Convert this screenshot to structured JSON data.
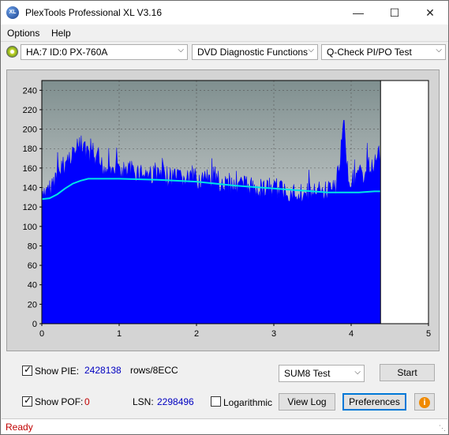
{
  "window": {
    "title": "PlexTools Professional XL V3.16",
    "icon": "XL"
  },
  "menu": {
    "items": [
      "Options",
      "Help"
    ]
  },
  "toolbar": {
    "drive": "HA:7 ID:0  PX-760A",
    "function": "DVD Diagnostic Functions",
    "test": "Q-Check PI/PO Test"
  },
  "chart_data": {
    "type": "area",
    "x_ticks": [
      "0",
      "1",
      "2",
      "3",
      "4",
      "5"
    ],
    "y_ticks": [
      "0",
      "20",
      "40",
      "60",
      "80",
      "100",
      "120",
      "140",
      "160",
      "180",
      "200",
      "220",
      "240"
    ],
    "xlim": [
      0,
      5
    ],
    "ylim": [
      0,
      250
    ],
    "grid": true,
    "end_marker_x": 4.38,
    "series": [
      {
        "color": "#0000ff",
        "x": [
          0,
          0.1,
          0.2,
          0.3,
          0.4,
          0.5,
          0.6,
          0.7,
          0.8,
          0.9,
          1.0,
          1.2,
          1.4,
          1.6,
          1.8,
          2.0,
          2.2,
          2.4,
          2.6,
          2.8,
          3.0,
          3.2,
          3.4,
          3.6,
          3.8,
          3.85,
          3.9,
          3.95,
          4.0,
          4.1,
          4.2,
          4.3,
          4.38
        ],
        "y": [
          138,
          148,
          165,
          175,
          188,
          195,
          183,
          178,
          172,
          170,
          168,
          168,
          165,
          162,
          160,
          160,
          158,
          155,
          154,
          150,
          150,
          147,
          145,
          145,
          152,
          175,
          228,
          168,
          158,
          160,
          167,
          178,
          185
        ]
      },
      {
        "color": "#00e5e5",
        "x": [
          0,
          0.1,
          0.2,
          0.3,
          0.4,
          0.5,
          0.6,
          0.7,
          0.8,
          1.0,
          1.5,
          2.0,
          2.5,
          3.0,
          3.5,
          3.7,
          3.9,
          4.1,
          4.3,
          4.38
        ],
        "y": [
          128,
          129,
          133,
          139,
          144,
          147,
          149,
          149,
          149,
          149,
          148,
          146,
          142,
          139,
          136,
          135,
          135,
          135,
          136,
          136
        ]
      }
    ]
  },
  "controls": {
    "show_pie_label": "Show PIE:",
    "pie_value": "2428138",
    "rows_label": "rows/8ECC",
    "show_pof_label": "Show POF:",
    "pof_value": "0",
    "lsn_label": "LSN:",
    "lsn_value": "2298496",
    "log_label": "Logarithmic",
    "sum_select": "SUM8 Test",
    "start_button": "Start",
    "view_log_button": "View Log",
    "preferences_button": "Preferences"
  },
  "status": {
    "text": "Ready"
  }
}
